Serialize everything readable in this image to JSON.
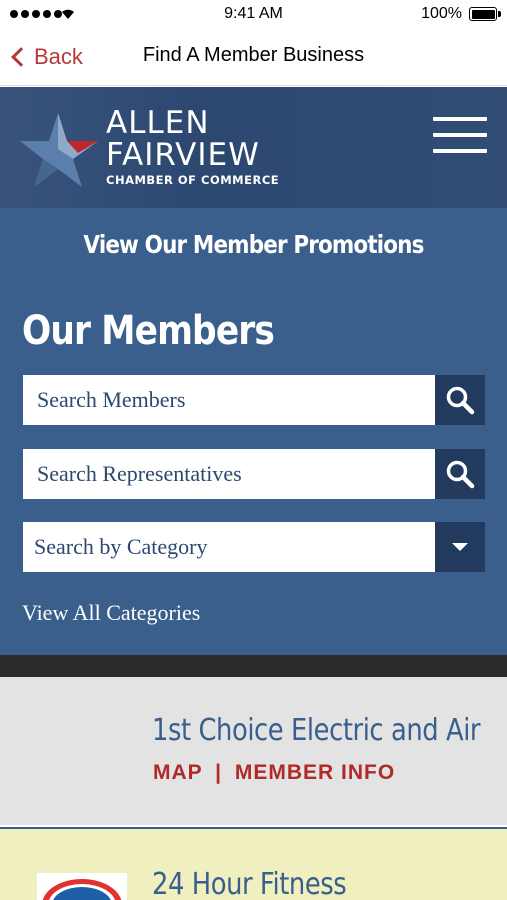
{
  "status_bar": {
    "time": "9:41 AM",
    "battery": "100%"
  },
  "nav": {
    "back_label": "Back",
    "title": "Find A Member Business"
  },
  "header": {
    "logo_line1": "ALLEN",
    "logo_line2": "FAIRVIEW",
    "logo_line3": "CHAMBER OF COMMERCE",
    "menu_icon": "hamburger-menu-icon"
  },
  "search_panel": {
    "promo_link": "View Our Member Promotions",
    "title": "Our Members",
    "search_members_placeholder": "Search Members",
    "search_reps_placeholder": "Search Representatives",
    "category_placeholder": "Search by Category",
    "view_all": "View All Categories"
  },
  "members": [
    {
      "name": "1st Choice Electric and Air",
      "map_label": "MAP",
      "separator": "|",
      "info_label": "MEMBER INFO"
    },
    {
      "name": "24 Hour Fitness"
    }
  ],
  "colors": {
    "accent_red": "#b23a3a",
    "panel_blue": "#3a5f8c",
    "header_navy": "#2c4870",
    "button_navy": "#213a5e"
  }
}
